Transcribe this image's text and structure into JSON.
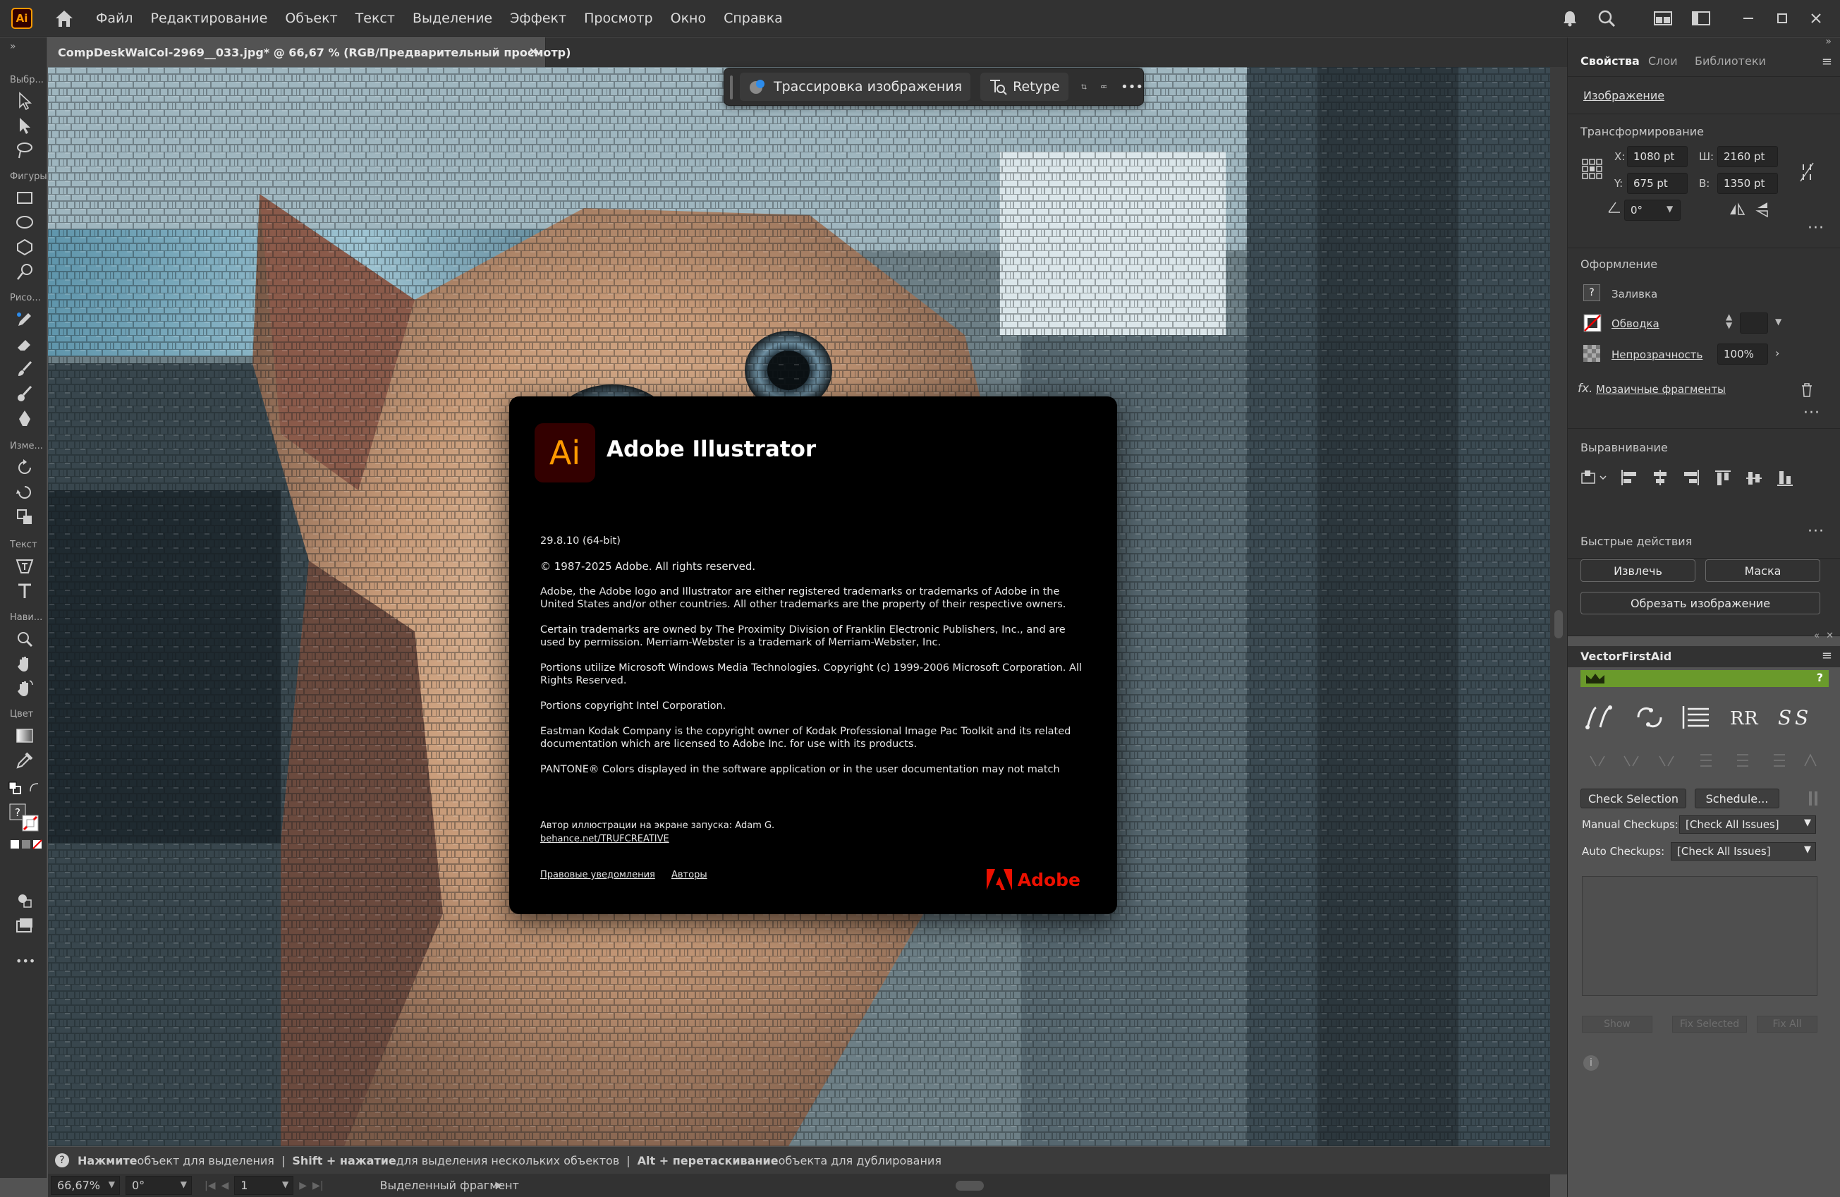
{
  "app": {
    "logo_text": "Ai"
  },
  "menu": [
    "Файл",
    "Редактирование",
    "Объект",
    "Текст",
    "Выделение",
    "Эффект",
    "Просмотр",
    "Окно",
    "Справка"
  ],
  "document_tab": {
    "title": "CompDeskWalCol-2969__033.jpg* @ 66,67 % (RGB/Предварительный просмотр)",
    "close": "×"
  },
  "toolbar": {
    "groups": [
      "Выбр...",
      "Фигуры",
      "Рисо...",
      "Изме...",
      "Текст",
      "Нави...",
      "Цвет"
    ],
    "more": "•••"
  },
  "context_bar": {
    "trace_label": "Трассировка изображения",
    "retype_label": "Retype",
    "more": "•••"
  },
  "about": {
    "logo_text": "Ai",
    "title": "Adobe Illustrator",
    "version": "29.8.10 (64-bit)",
    "copyright": "© 1987-2025 Adobe. All rights reserved.",
    "legal_1": "Adobe, the Adobe logo and Illustrator are either registered trademarks or trademarks of Adobe in the United States and/or other countries. All other trademarks are the property of their respective owners.",
    "legal_2": "Certain trademarks are owned by The Proximity Division of Franklin Electronic Publishers, Inc., and are used by permission. Merriam-Webster is a trademark of Merriam-Webster, Inc.",
    "legal_3": "Portions utilize Microsoft Windows Media Technologies. Copyright (c) 1999-2006 Microsoft Corporation. All Rights Reserved.",
    "legal_4": "Portions copyright Intel Corporation.",
    "legal_5": "Eastman Kodak Company is the copyright owner of Kodak Professional Image Pac Toolkit and its related documentation which are licensed to Adobe Inc. for use with its products.",
    "legal_6": "PANTONE® Colors displayed in the software application or in the user documentation may not match",
    "artwork_credit": "Автор иллюстрации на экране запуска: Adam G.",
    "artwork_link": "behance.net/TRUFCREATIVE",
    "legal_notices_link": "Правовые уведомления",
    "authors_link": "Авторы",
    "brand": "Adobe"
  },
  "hint_bar": {
    "part1_bold": "Нажмите",
    "part1": " объект для выделения",
    "sep": "|",
    "part2_bold": "Shift + нажатие",
    "part2": " для выделения нескольких объектов",
    "part3_bold": "Alt + перетаскивание",
    "part3": " объекта для дублирования"
  },
  "bottom_bar": {
    "zoom": "66,67%",
    "rotation": "0°",
    "artboard": "1",
    "status": "Выделенный фрагмент"
  },
  "properties": {
    "tabs": [
      "Свойства",
      "Слои",
      "Библиотеки"
    ],
    "object_type": "Изображение",
    "transform": {
      "title": "Трансформирование",
      "x_label": "X:",
      "x": "1080 pt",
      "y_label": "Y:",
      "y": "675 pt",
      "w_label": "Ш:",
      "w": "2160 pt",
      "h_label": "В:",
      "h": "1350 pt",
      "angle": "0°"
    },
    "appearance": {
      "title": "Оформление",
      "fill_label": "Заливка",
      "stroke_label": "Обводка",
      "opacity_label": "Непрозрачность",
      "opacity": "100%",
      "effect": "Мозаичные фрагменты",
      "fx": "fx."
    },
    "align": {
      "title": "Выравнивание"
    },
    "quick_actions": {
      "title": "Быстрые действия",
      "extract": "Извлечь",
      "mask": "Маска",
      "crop": "Обрезать изображение"
    }
  },
  "vfa": {
    "title": "VectorFirstAid",
    "check_selection": "Check Selection",
    "schedule": "Schedule...",
    "manual_label": "Manual Checkups:",
    "manual_value": "[Check All Issues]",
    "auto_label": "Auto Checkups:",
    "auto_value": "[Check All Issues]",
    "show": "Show",
    "fix_selected": "Fix Selected",
    "fix_all": "Fix All"
  },
  "colors": {
    "accent": "#ff9a00",
    "adobe_red": "#eb1000",
    "vfa_green": "#6a9a2b"
  }
}
